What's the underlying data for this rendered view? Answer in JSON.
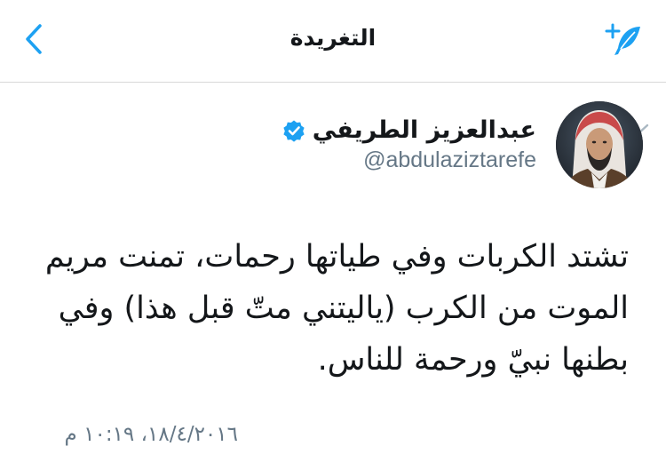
{
  "navbar": {
    "title": "التغريدة",
    "back_icon": "chevron-left-icon",
    "compose_icon": "compose-feather-icon",
    "accent_color": "#1da1f2"
  },
  "tweet": {
    "display_name": "عبدالعزيز الطريفي",
    "handle": "@abdulaziztarefe",
    "verified": true,
    "text": "تشتد الكربات وفي طياتها رحمات، تمنت مريم الموت من الكرب (ياليتني متّ قبل هذا) وفي بطنها نبيّ ورحمة للناس.",
    "timestamp": "١٨/٤/٢٠١٦، ١٠:١٩ م"
  },
  "colors": {
    "text_primary": "#14171a",
    "text_secondary": "#657786",
    "verified_blue": "#1da1f2",
    "divider": "#d8d8d8"
  }
}
